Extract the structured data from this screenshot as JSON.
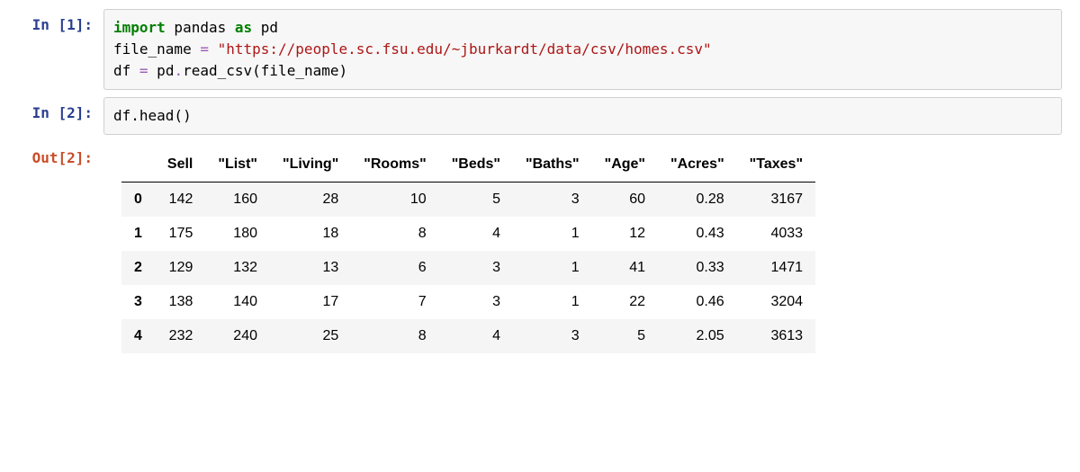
{
  "cells": [
    {
      "prompt_in": "In [1]:",
      "code": {
        "kw_import": "import",
        "mod": " pandas ",
        "kw_as": "as",
        "alias": " pd",
        "line2a": "file_name ",
        "eq1": "=",
        "str_url": " \"https://people.sc.fsu.edu/~jburkardt/data/csv/homes.csv\"",
        "line3a": "df ",
        "eq2": "=",
        "line3b": " pd",
        "dot": ".",
        "line3c": "read_csv(file_name)"
      }
    },
    {
      "prompt_in": "In [2]:",
      "code_plain": "df.head()"
    }
  ],
  "out": {
    "prompt": "Out[2]:",
    "columns": [
      "Sell",
      "\"List\"",
      "\"Living\"",
      "\"Rooms\"",
      "\"Beds\"",
      "\"Baths\"",
      "\"Age\"",
      "\"Acres\"",
      "\"Taxes\""
    ],
    "index": [
      "0",
      "1",
      "2",
      "3",
      "4"
    ],
    "rows": [
      [
        "142",
        "160",
        "28",
        "10",
        "5",
        "3",
        "60",
        "0.28",
        "3167"
      ],
      [
        "175",
        "180",
        "18",
        "8",
        "4",
        "1",
        "12",
        "0.43",
        "4033"
      ],
      [
        "129",
        "132",
        "13",
        "6",
        "3",
        "1",
        "41",
        "0.33",
        "1471"
      ],
      [
        "138",
        "140",
        "17",
        "7",
        "3",
        "1",
        "22",
        "0.46",
        "3204"
      ],
      [
        "232",
        "240",
        "25",
        "8",
        "4",
        "3",
        "5",
        "2.05",
        "3613"
      ]
    ]
  }
}
